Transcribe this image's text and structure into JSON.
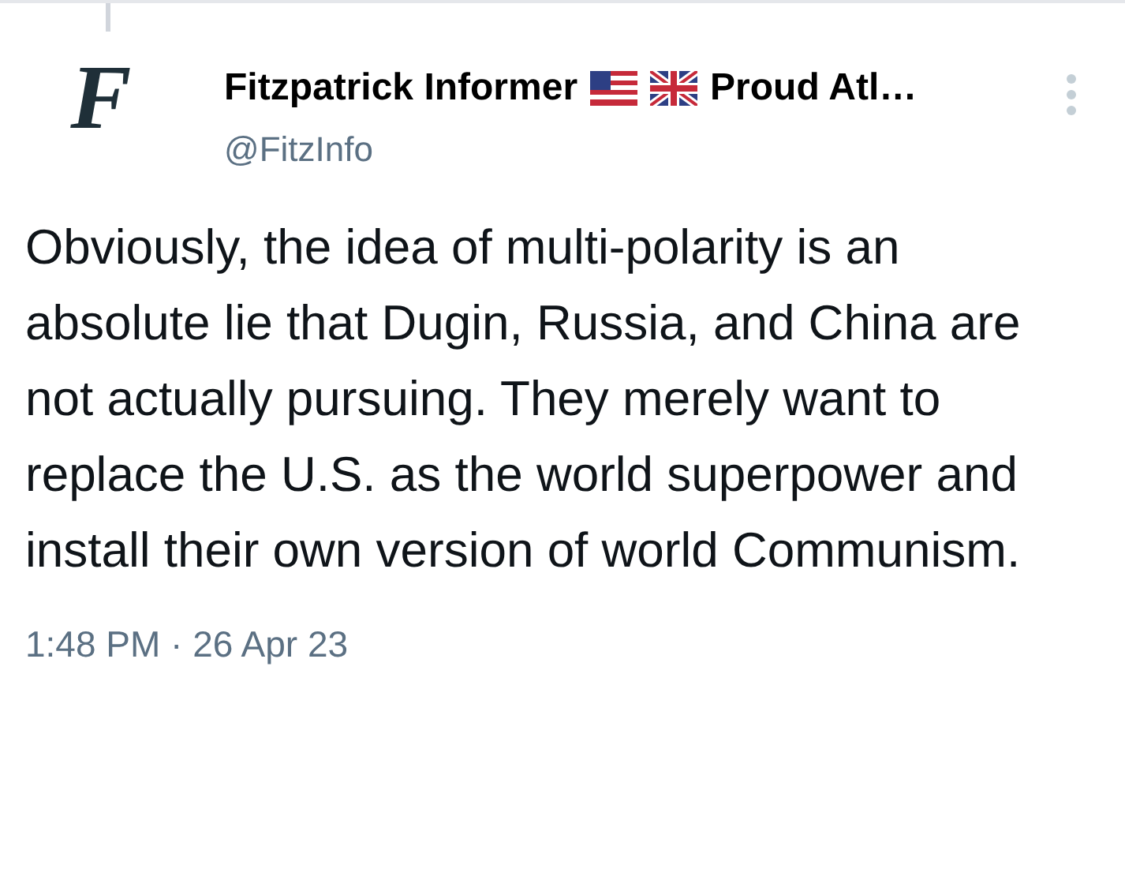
{
  "tweet": {
    "avatar_letter": "F",
    "display_name": "Fitzpatrick Informer",
    "name_suffix": "Proud Atl…",
    "handle": "@FitzInfo",
    "text": "Obviously, the idea of multi-polarity is an absolute lie that Dugin, Russia, and China are not actually pursuing. They merely want to replace the U.S. as the world superpower and install their own version of world Communism.",
    "timestamp": "1:48 PM · 26 Apr 23"
  }
}
